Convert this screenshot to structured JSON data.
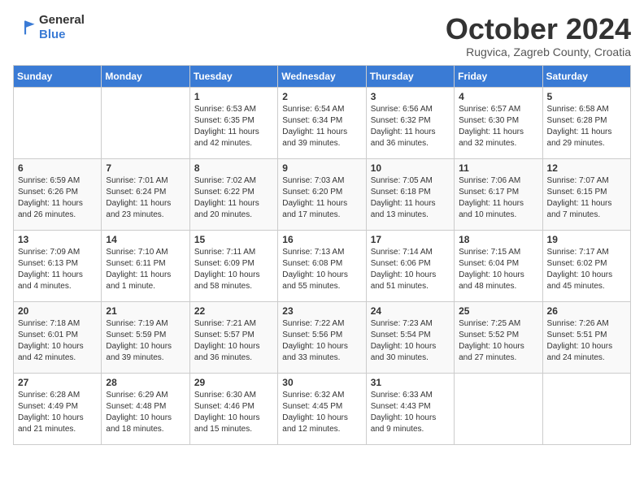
{
  "header": {
    "logo_general": "General",
    "logo_blue": "Blue",
    "month_title": "October 2024",
    "location": "Rugvica, Zagreb County, Croatia"
  },
  "days_of_week": [
    "Sunday",
    "Monday",
    "Tuesday",
    "Wednesday",
    "Thursday",
    "Friday",
    "Saturday"
  ],
  "weeks": [
    [
      {
        "day": "",
        "info": ""
      },
      {
        "day": "",
        "info": ""
      },
      {
        "day": "1",
        "sunrise": "6:53 AM",
        "sunset": "6:35 PM",
        "daylight": "11 hours and 42 minutes."
      },
      {
        "day": "2",
        "sunrise": "6:54 AM",
        "sunset": "6:34 PM",
        "daylight": "11 hours and 39 minutes."
      },
      {
        "day": "3",
        "sunrise": "6:56 AM",
        "sunset": "6:32 PM",
        "daylight": "11 hours and 36 minutes."
      },
      {
        "day": "4",
        "sunrise": "6:57 AM",
        "sunset": "6:30 PM",
        "daylight": "11 hours and 32 minutes."
      },
      {
        "day": "5",
        "sunrise": "6:58 AM",
        "sunset": "6:28 PM",
        "daylight": "11 hours and 29 minutes."
      }
    ],
    [
      {
        "day": "6",
        "sunrise": "6:59 AM",
        "sunset": "6:26 PM",
        "daylight": "11 hours and 26 minutes."
      },
      {
        "day": "7",
        "sunrise": "7:01 AM",
        "sunset": "6:24 PM",
        "daylight": "11 hours and 23 minutes."
      },
      {
        "day": "8",
        "sunrise": "7:02 AM",
        "sunset": "6:22 PM",
        "daylight": "11 hours and 20 minutes."
      },
      {
        "day": "9",
        "sunrise": "7:03 AM",
        "sunset": "6:20 PM",
        "daylight": "11 hours and 17 minutes."
      },
      {
        "day": "10",
        "sunrise": "7:05 AM",
        "sunset": "6:18 PM",
        "daylight": "11 hours and 13 minutes."
      },
      {
        "day": "11",
        "sunrise": "7:06 AM",
        "sunset": "6:17 PM",
        "daylight": "11 hours and 10 minutes."
      },
      {
        "day": "12",
        "sunrise": "7:07 AM",
        "sunset": "6:15 PM",
        "daylight": "11 hours and 7 minutes."
      }
    ],
    [
      {
        "day": "13",
        "sunrise": "7:09 AM",
        "sunset": "6:13 PM",
        "daylight": "11 hours and 4 minutes."
      },
      {
        "day": "14",
        "sunrise": "7:10 AM",
        "sunset": "6:11 PM",
        "daylight": "11 hours and 1 minute."
      },
      {
        "day": "15",
        "sunrise": "7:11 AM",
        "sunset": "6:09 PM",
        "daylight": "10 hours and 58 minutes."
      },
      {
        "day": "16",
        "sunrise": "7:13 AM",
        "sunset": "6:08 PM",
        "daylight": "10 hours and 55 minutes."
      },
      {
        "day": "17",
        "sunrise": "7:14 AM",
        "sunset": "6:06 PM",
        "daylight": "10 hours and 51 minutes."
      },
      {
        "day": "18",
        "sunrise": "7:15 AM",
        "sunset": "6:04 PM",
        "daylight": "10 hours and 48 minutes."
      },
      {
        "day": "19",
        "sunrise": "7:17 AM",
        "sunset": "6:02 PM",
        "daylight": "10 hours and 45 minutes."
      }
    ],
    [
      {
        "day": "20",
        "sunrise": "7:18 AM",
        "sunset": "6:01 PM",
        "daylight": "10 hours and 42 minutes."
      },
      {
        "day": "21",
        "sunrise": "7:19 AM",
        "sunset": "5:59 PM",
        "daylight": "10 hours and 39 minutes."
      },
      {
        "day": "22",
        "sunrise": "7:21 AM",
        "sunset": "5:57 PM",
        "daylight": "10 hours and 36 minutes."
      },
      {
        "day": "23",
        "sunrise": "7:22 AM",
        "sunset": "5:56 PM",
        "daylight": "10 hours and 33 minutes."
      },
      {
        "day": "24",
        "sunrise": "7:23 AM",
        "sunset": "5:54 PM",
        "daylight": "10 hours and 30 minutes."
      },
      {
        "day": "25",
        "sunrise": "7:25 AM",
        "sunset": "5:52 PM",
        "daylight": "10 hours and 27 minutes."
      },
      {
        "day": "26",
        "sunrise": "7:26 AM",
        "sunset": "5:51 PM",
        "daylight": "10 hours and 24 minutes."
      }
    ],
    [
      {
        "day": "27",
        "sunrise": "6:28 AM",
        "sunset": "4:49 PM",
        "daylight": "10 hours and 21 minutes."
      },
      {
        "day": "28",
        "sunrise": "6:29 AM",
        "sunset": "4:48 PM",
        "daylight": "10 hours and 18 minutes."
      },
      {
        "day": "29",
        "sunrise": "6:30 AM",
        "sunset": "4:46 PM",
        "daylight": "10 hours and 15 minutes."
      },
      {
        "day": "30",
        "sunrise": "6:32 AM",
        "sunset": "4:45 PM",
        "daylight": "10 hours and 12 minutes."
      },
      {
        "day": "31",
        "sunrise": "6:33 AM",
        "sunset": "4:43 PM",
        "daylight": "10 hours and 9 minutes."
      },
      {
        "day": "",
        "info": ""
      },
      {
        "day": "",
        "info": ""
      }
    ]
  ]
}
